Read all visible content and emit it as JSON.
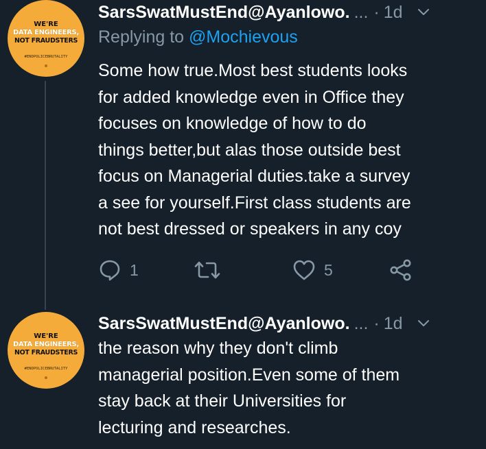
{
  "tweets": [
    {
      "avatar": {
        "line1": "WE'RE",
        "line2": "DATA ENGINEERS,",
        "line3": "NOT FRAUDSTERS",
        "hashtag": "#ENDPOLICEBRUTALITY"
      },
      "author": "SarsSwatMustEnd@Ayanlowo.",
      "ellipsis": "...",
      "separator": "·",
      "time": "1d",
      "replying_to_prefix": "Replying to ",
      "replying_to_handle": "@Mochievous",
      "lines": [
        "Some how true.Most best students looks",
        "for added knowledge even in Office they",
        "focuses on knowledge of how to do",
        "things better,but alas those outside best",
        "focus on Managerial duties.take a survey",
        "a see for yourself.First class students are",
        "not best dressed or speakers in any coy"
      ],
      "actions": {
        "reply_count": "1",
        "retweet_count": "",
        "like_count": "5"
      },
      "icons": {
        "reply": "reply-icon",
        "retweet": "retweet-icon",
        "like": "heart-icon",
        "share": "share-icon",
        "menu": "chevron-down-icon"
      }
    },
    {
      "avatar": {
        "line1": "WE'RE",
        "line2": "DATA ENGINEERS,",
        "line3": "NOT FRAUDSTERS",
        "hashtag": "#ENDPOLICEBRUTALITY"
      },
      "author": "SarsSwatMustEnd@Ayanlowo.",
      "ellipsis": "...",
      "separator": "·",
      "time": "1d",
      "lines": [
        "the reason why they don't climb",
        "managerial position.Even some of them",
        "stay back at their Universities for",
        "lecturing and researches."
      ],
      "icons": {
        "menu": "chevron-down-icon"
      }
    }
  ],
  "colors": {
    "background": "#15202b",
    "text": "#ffffff",
    "muted": "#8899a6",
    "link": "#1da1f2",
    "avatar_bg": "#f4ab3a",
    "thread_line": "#38444d"
  }
}
